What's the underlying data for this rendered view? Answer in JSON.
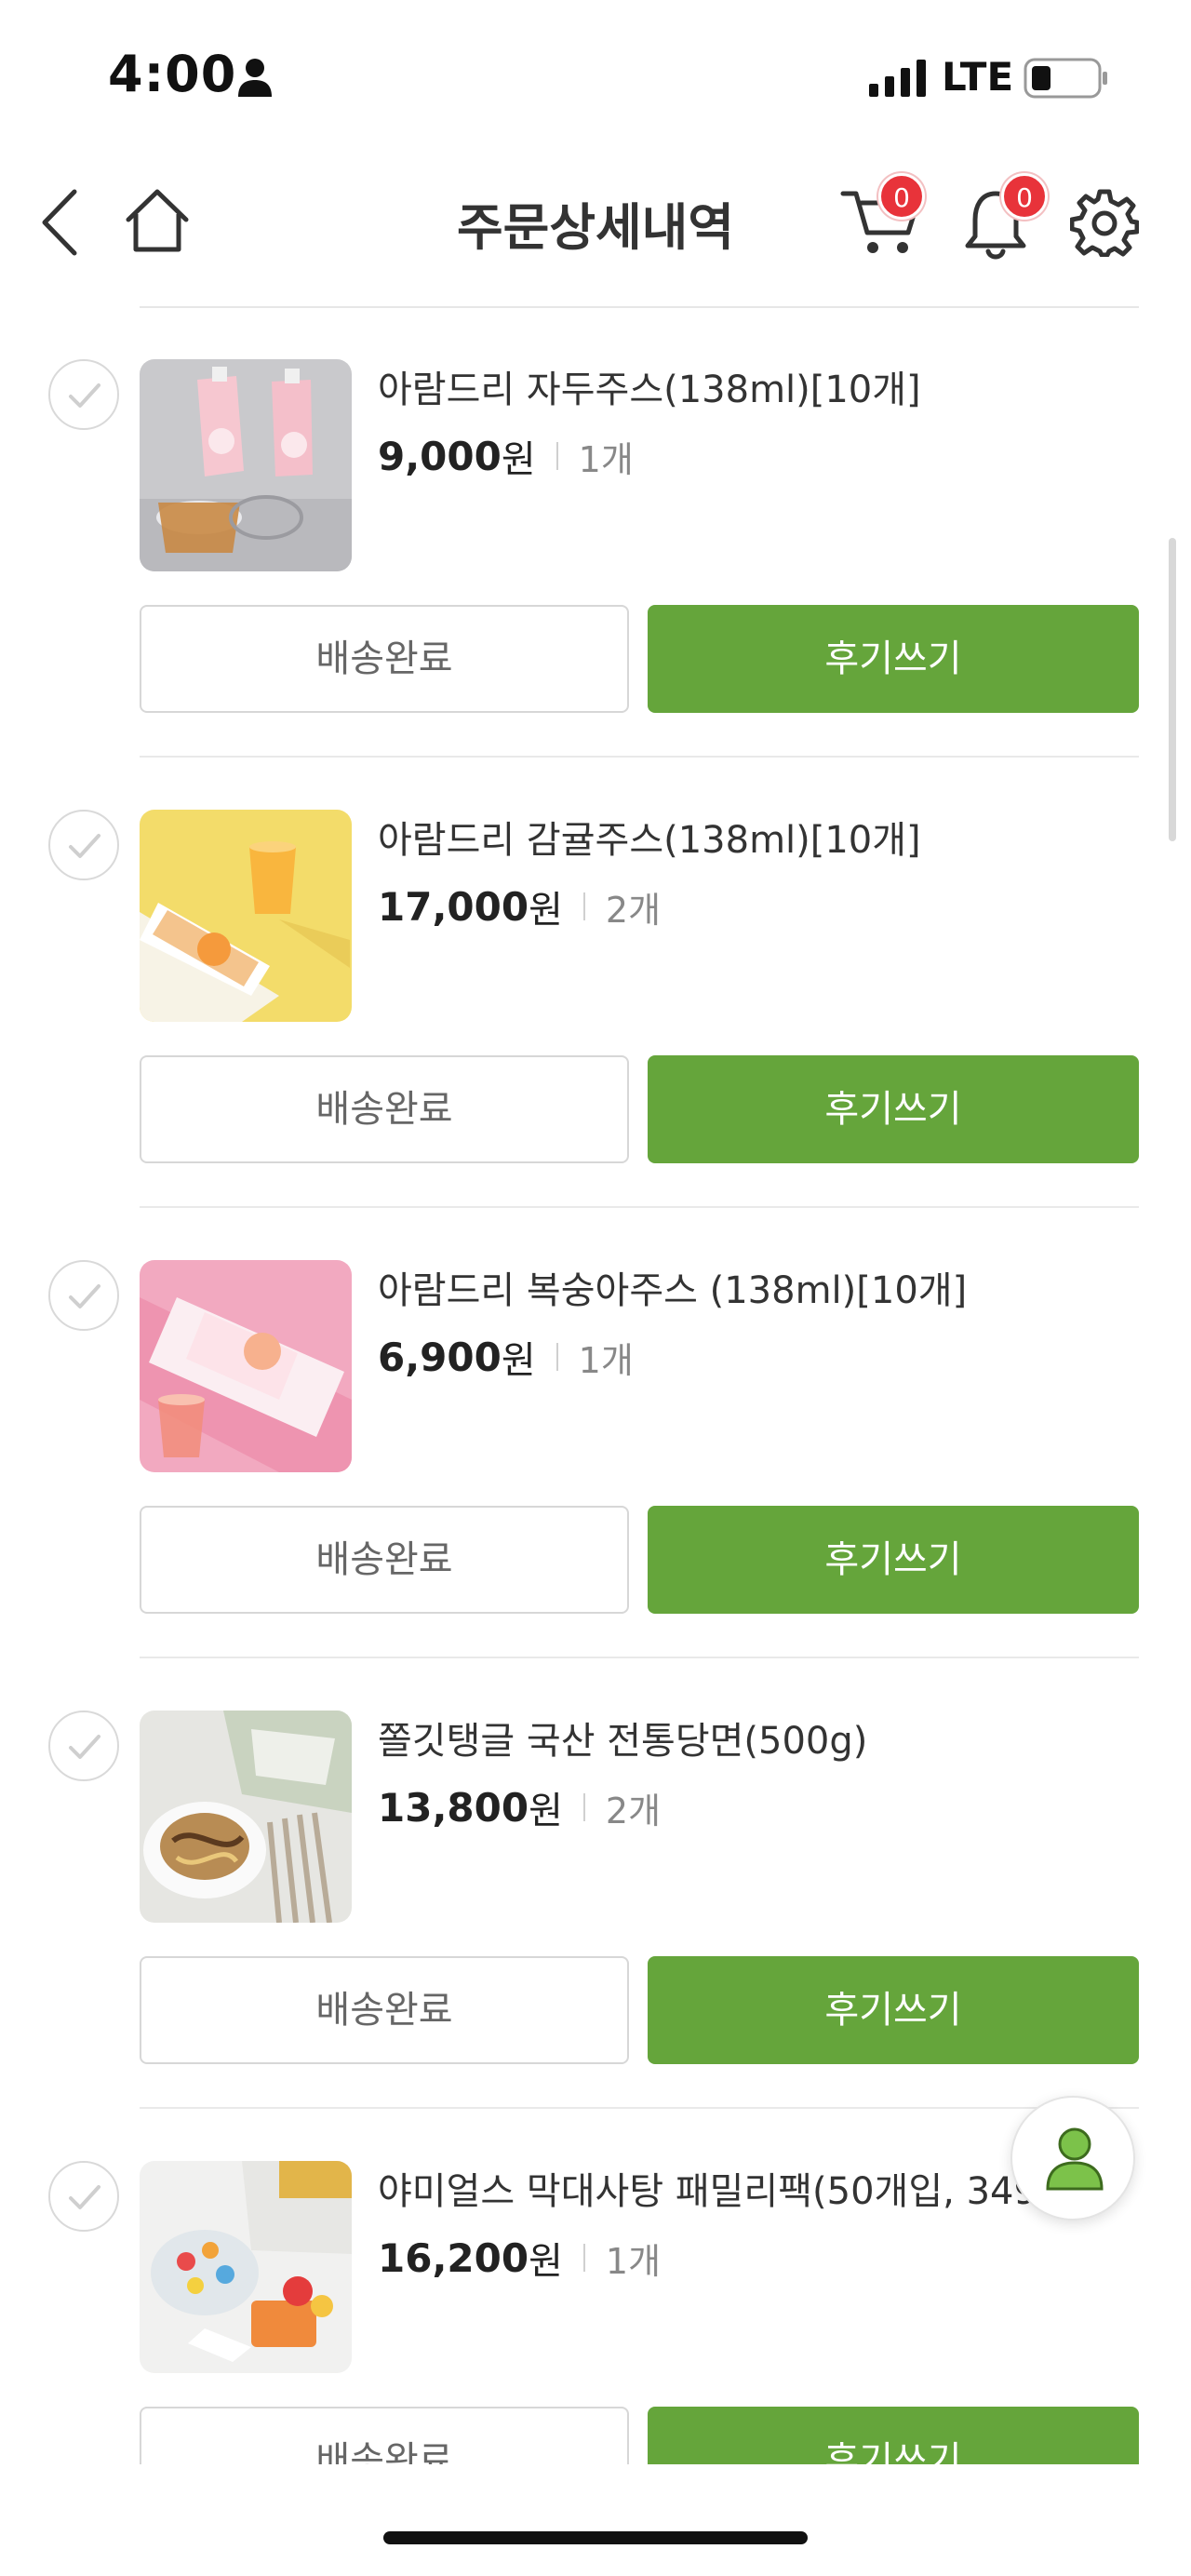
{
  "status_bar": {
    "time": "4:00",
    "network": "LTE",
    "icons": [
      "person-icon",
      "signal-icon",
      "battery-icon"
    ]
  },
  "header": {
    "title": "주문상세내역",
    "cart_count": "0",
    "notification_count": "0",
    "icons": [
      "back-icon",
      "home-icon",
      "cart-icon",
      "bell-icon",
      "gear-icon"
    ]
  },
  "colors": {
    "accent_green": "#65a53b",
    "badge_red": "#e8333a",
    "divider": "#e9e9e9"
  },
  "items": [
    {
      "name": "아람드리 자두주스(138ml)[10개]",
      "price": "9,000",
      "currency": "원",
      "quantity": "1개",
      "status_label": "배송완료",
      "review_label": "후기쓰기"
    },
    {
      "name": "아람드리 감귤주스(138ml)[10개]",
      "price": "17,000",
      "currency": "원",
      "quantity": "2개",
      "status_label": "배송완료",
      "review_label": "후기쓰기"
    },
    {
      "name": "아람드리 복숭아주스 (138ml)[10개]",
      "price": "6,900",
      "currency": "원",
      "quantity": "1개",
      "status_label": "배송완료",
      "review_label": "후기쓰기"
    },
    {
      "name": "쫄깃탱글 국산 전통당면(500g)",
      "price": "13,800",
      "currency": "원",
      "quantity": "2개",
      "status_label": "배송완료",
      "review_label": "후기쓰기"
    },
    {
      "name": "야미얼스 막대사탕 패밀리팩(50개입, 349g)",
      "price": "16,200",
      "currency": "원",
      "quantity": "1개",
      "status_label": "배송완료",
      "review_label": "후기쓰기"
    }
  ],
  "floating_button": {
    "icon": "person-icon"
  }
}
